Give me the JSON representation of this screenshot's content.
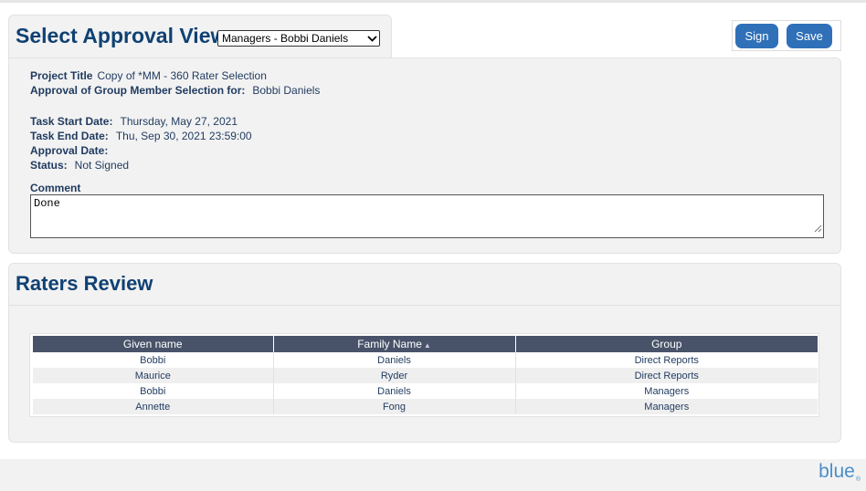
{
  "header": {
    "title": "Select Approval View",
    "view_select": {
      "value": "Managers - Bobbi Daniels"
    },
    "buttons": {
      "sign": "Sign",
      "save": "Save"
    }
  },
  "info": {
    "project_title_label": "Project Title",
    "project_title": "Copy of *MM - 360 Rater Selection",
    "approval_for_label": "Approval of Group Member Selection for:",
    "approval_for": "Bobbi Daniels",
    "task_start_label": "Task Start Date:",
    "task_start": "Thursday, May 27, 2021",
    "task_end_label": "Task End Date:",
    "task_end": "Thu, Sep 30, 2021 23:59:00",
    "approval_date_label": "Approval Date:",
    "approval_date": "",
    "status_label": "Status:",
    "status": "Not Signed",
    "comment_label": "Comment",
    "comment_value": "Done"
  },
  "raters": {
    "title": "Raters Review",
    "columns": [
      "Given name",
      "Family Name",
      "Group"
    ],
    "sort_column": "Family Name",
    "sort_icon": "sort-ascending-icon",
    "rows": [
      [
        "Bobbi",
        "Daniels",
        "Direct Reports"
      ],
      [
        "Maurice",
        "Ryder",
        "Direct Reports"
      ],
      [
        "Bobbi",
        "Daniels",
        "Managers"
      ],
      [
        "Annette",
        "Fong",
        "Managers"
      ]
    ]
  },
  "footer": {
    "logo_text": "blue",
    "logo_mark": "®"
  },
  "colors": {
    "title": "#0f4173",
    "button": "#2f70b8",
    "table_header": "#48536a",
    "panel_bg": "#f2f2f2",
    "logo": "#4a8fc9"
  }
}
